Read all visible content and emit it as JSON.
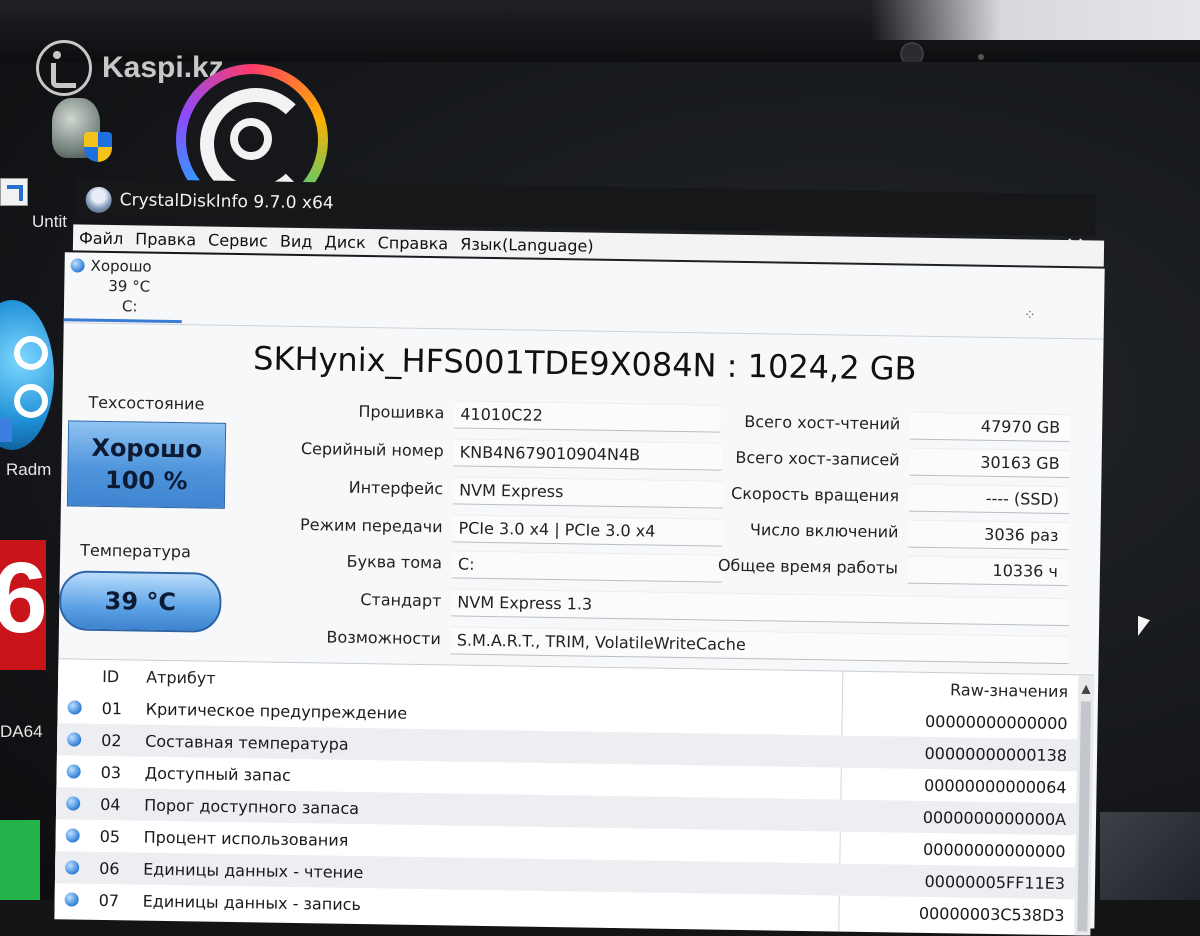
{
  "watermark": {
    "text": "Kaspi.kz"
  },
  "desktop": {
    "labels": [
      "Untit",
      "Radm",
      "DA64"
    ],
    "red_tile_digit": "6"
  },
  "window": {
    "title": "CrystalDiskInfo 9.7.0 x64",
    "menu": [
      "Файл",
      "Правка",
      "Сервис",
      "Вид",
      "Диск",
      "Справка",
      "Язык(Language)"
    ],
    "close_glyph": "✕"
  },
  "disk_tab": {
    "status": "Хорошо",
    "temp": "39 °C",
    "letter": "C:"
  },
  "disk": {
    "title": "SKHynix_HFS001TDE9X084N : 1024,2 GB"
  },
  "health": {
    "label": "Техсостояние",
    "status": "Хорошо",
    "percent": "100 %"
  },
  "temperature": {
    "label": "Температура",
    "value": "39 °C"
  },
  "info_left": [
    {
      "label": "Прошивка",
      "value": "41010C22"
    },
    {
      "label": "Серийный номер",
      "value": "KNB4N679010904N4B"
    },
    {
      "label": "Интерфейс",
      "value": "NVM Express"
    },
    {
      "label": "Режим передачи",
      "value": "PCIe 3.0 x4 | PCIe 3.0 x4"
    },
    {
      "label": "Буква тома",
      "value": "C:"
    },
    {
      "label": "Стандарт",
      "value": "NVM Express 1.3"
    },
    {
      "label": "Возможности",
      "value": "S.M.A.R.T., TRIM, VolatileWriteCache"
    }
  ],
  "info_right": [
    {
      "label": "Всего хост-чтений",
      "value": "47970 GB"
    },
    {
      "label": "Всего хост-записей",
      "value": "30163 GB"
    },
    {
      "label": "Скорость вращения",
      "value": "---- (SSD)"
    },
    {
      "label": "Число включений",
      "value": "3036 раз"
    },
    {
      "label": "Общее время работы",
      "value": "10336 ч"
    }
  ],
  "smart": {
    "headers": {
      "id": "ID",
      "attribute": "Атрибут",
      "raw": "Raw-значения"
    },
    "rows": [
      {
        "id": "01",
        "attribute": "Критическое предупреждение",
        "raw": "00000000000000"
      },
      {
        "id": "02",
        "attribute": "Составная температура",
        "raw": "00000000000138"
      },
      {
        "id": "03",
        "attribute": "Доступный запас",
        "raw": "00000000000064"
      },
      {
        "id": "04",
        "attribute": "Порог доступного запаса",
        "raw": "0000000000000A"
      },
      {
        "id": "05",
        "attribute": "Процент использования",
        "raw": "00000000000000"
      },
      {
        "id": "06",
        "attribute": "Единицы данных - чтение",
        "raw": "00000005FF11E3"
      },
      {
        "id": "07",
        "attribute": "Единицы данных - запись",
        "raw": "00000003C538D3"
      }
    ]
  },
  "colors": {
    "status_blue": "#3a7bd5",
    "window_bg": "#f7f8f9",
    "titlebar": "#151719"
  }
}
